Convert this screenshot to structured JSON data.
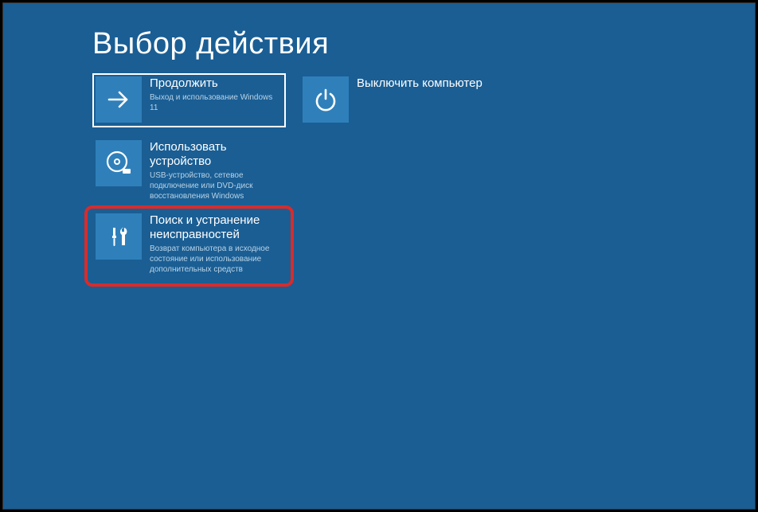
{
  "title": "Выбор действия",
  "tiles": {
    "continue": {
      "title": "Продолжить",
      "desc": "Выход и использование Windows 11"
    },
    "device": {
      "title": "Использовать устройство",
      "desc": "USB-устройство, сетевое подключение или DVD-диск восстановления Windows"
    },
    "troubleshoot": {
      "title": "Поиск и устранение неисправностей",
      "desc": "Возврат компьютера в исходное состояние или использование дополнительных средств"
    },
    "shutdown": {
      "title": "Выключить компьютер"
    }
  }
}
